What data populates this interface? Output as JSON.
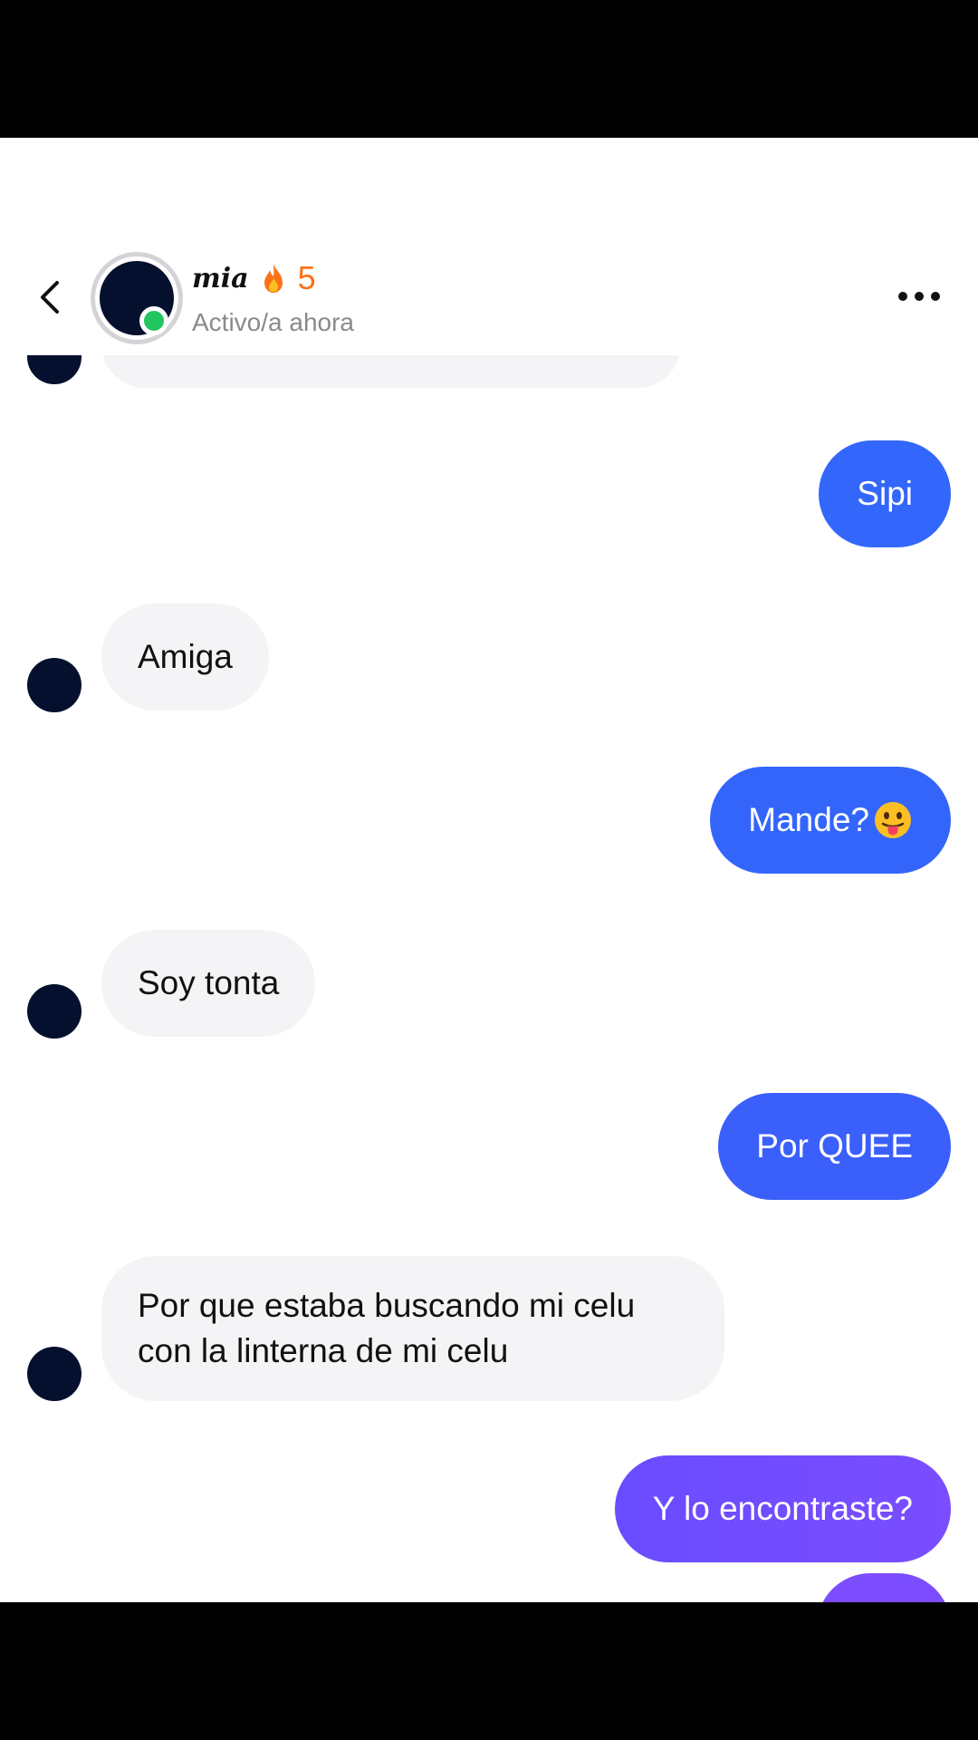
{
  "header": {
    "contact_name": "mia",
    "streak_count": "5",
    "status": "Activo/a ahora",
    "back_icon": "chevron-left-icon",
    "more_icon": "more-horizontal-icon",
    "flame_icon": "flame-icon"
  },
  "messages": [
    {
      "from": "them",
      "text": ""
    },
    {
      "from": "me",
      "text": "Sipi"
    },
    {
      "from": "them",
      "text": "Amiga"
    },
    {
      "from": "me",
      "text": "Mande?",
      "emoji": "tongue-out-face-icon"
    },
    {
      "from": "them",
      "text": "Soy tonta"
    },
    {
      "from": "me",
      "text": "Por QUEE"
    },
    {
      "from": "them",
      "text": "Por que estaba buscando mi celu con la linterna de mi celu"
    },
    {
      "from": "me",
      "text": "Y lo encontraste?"
    },
    {
      "from": "me",
      "text": ""
    }
  ],
  "colors": {
    "incoming_bubble": "#f4f4f6",
    "outgoing_gradient_top": "#3066ff",
    "outgoing_gradient_bottom": "#7b4dff",
    "online": "#22c55e",
    "streak": "#f97316",
    "avatar": "#04102e"
  }
}
